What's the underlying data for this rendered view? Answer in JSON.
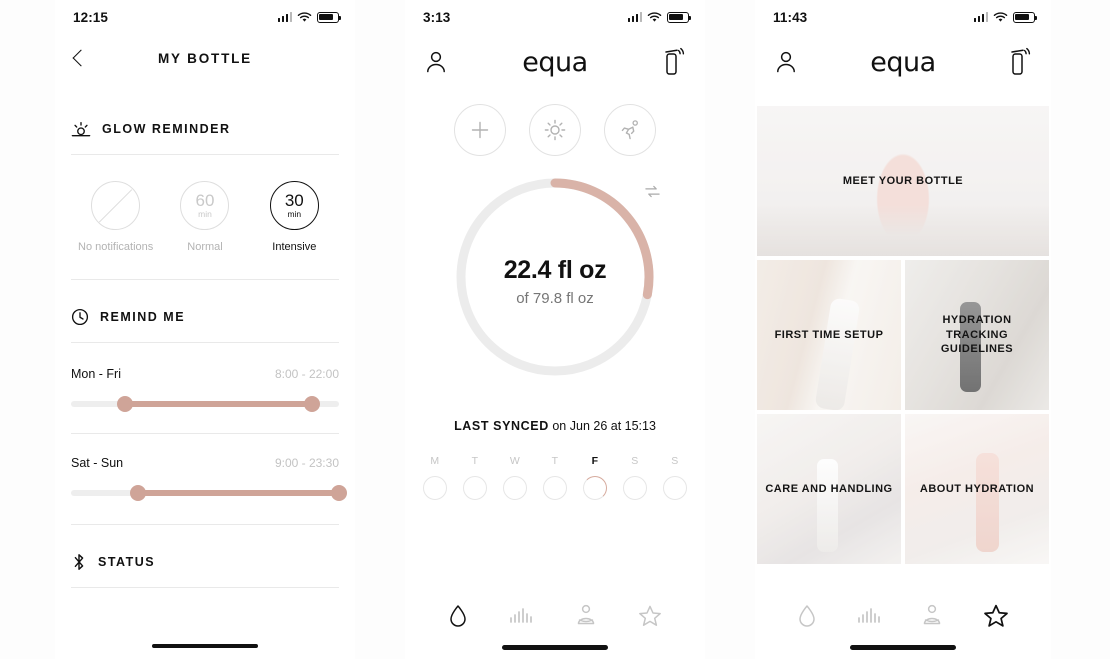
{
  "accent": "#cfa498",
  "phone1": {
    "status": {
      "time": "12:15"
    },
    "nav": {
      "title": "MY BOTTLE",
      "back_icon": "chevron-left-icon"
    },
    "glow_section": {
      "icon": "sunrise-icon",
      "title": "GLOW REMINDER",
      "options": [
        {
          "value": "",
          "unit": "",
          "label": "No notifications",
          "selected": false,
          "icon": "no-notifications-icon"
        },
        {
          "value": "60",
          "unit": "min",
          "label": "Normal",
          "selected": false
        },
        {
          "value": "30",
          "unit": "min",
          "label": "Intensive",
          "selected": true
        }
      ]
    },
    "remind_section": {
      "icon": "clock-icon",
      "title": "REMIND ME",
      "rows": [
        {
          "days": "Mon - Fri",
          "range": "8:00 - 22:00",
          "start_pct": 20,
          "end_pct": 90
        },
        {
          "days": "Sat - Sun",
          "range": "9:00 - 23:30",
          "start_pct": 25,
          "end_pct": 100
        }
      ]
    },
    "status_section": {
      "icon": "bluetooth-icon",
      "title": "STATUS"
    }
  },
  "phone2": {
    "status": {
      "time": "3:13"
    },
    "nav": {
      "profile_icon": "person-icon",
      "logo": "equa",
      "bottle_icon": "bottle-signal-icon"
    },
    "quick_actions": [
      {
        "name": "add-intake-button",
        "icon": "plus-icon"
      },
      {
        "name": "weather-button",
        "icon": "sun-icon"
      },
      {
        "name": "activity-button",
        "icon": "running-icon"
      }
    ],
    "ring": {
      "current": "22.4 fl oz",
      "target": "of 79.8 fl oz",
      "progress_pct": 28,
      "sync_icon": "sync-icon"
    },
    "last_synced": {
      "label": "LAST SYNCED",
      "detail": "on Jun 26 at 15:13"
    },
    "week": {
      "days": [
        {
          "letter": "M",
          "active": false
        },
        {
          "letter": "T",
          "active": false
        },
        {
          "letter": "W",
          "active": false
        },
        {
          "letter": "T",
          "active": false
        },
        {
          "letter": "F",
          "active": true
        },
        {
          "letter": "S",
          "active": false
        },
        {
          "letter": "S",
          "active": false
        }
      ]
    },
    "tabs": [
      {
        "name": "tab-hydration",
        "icon": "drop-icon",
        "active": true
      },
      {
        "name": "tab-stats",
        "icon": "bars-icon",
        "active": false
      },
      {
        "name": "tab-profile",
        "icon": "meditation-icon",
        "active": false
      },
      {
        "name": "tab-discover",
        "icon": "star-icon",
        "active": false
      }
    ]
  },
  "phone3": {
    "status": {
      "time": "11:43"
    },
    "nav": {
      "profile_icon": "person-icon",
      "logo": "equa",
      "bottle_icon": "bottle-signal-icon"
    },
    "cards": [
      {
        "title": "MEET YOUR BOTTLE",
        "photo": "ph-hero"
      },
      {
        "title": "FIRST TIME SETUP",
        "photo": "ph-1"
      },
      {
        "title": "HYDRATION TRACKING GUIDELINES",
        "photo": "ph-2"
      },
      {
        "title": "CARE AND HANDLING",
        "photo": "ph-3"
      },
      {
        "title": "ABOUT HYDRATION",
        "photo": "ph-4"
      }
    ],
    "tabs": [
      {
        "name": "tab-hydration",
        "icon": "drop-icon",
        "active": false
      },
      {
        "name": "tab-stats",
        "icon": "bars-icon",
        "active": false
      },
      {
        "name": "tab-profile",
        "icon": "meditation-icon",
        "active": false
      },
      {
        "name": "tab-discover",
        "icon": "star-icon",
        "active": true
      }
    ]
  }
}
